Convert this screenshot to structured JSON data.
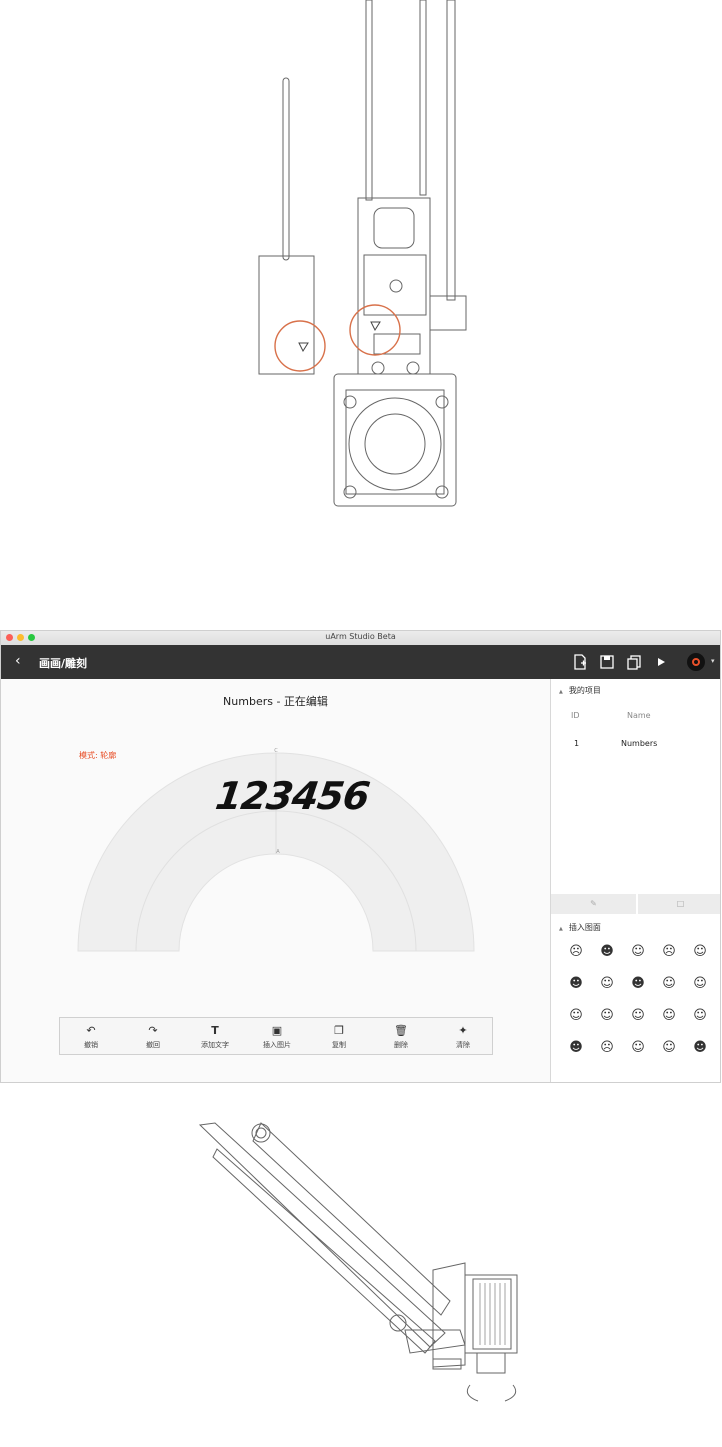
{
  "window": {
    "title": "uArm Studio Beta",
    "traffic_colors": [
      "#fc5f57",
      "#fdbc2e",
      "#28c840"
    ]
  },
  "toolbar": {
    "back_icon": "chevron-left-icon",
    "breadcrumb": "画画/雕刻",
    "actions": [
      "new-file-icon",
      "save-icon",
      "copy-icon",
      "play-icon"
    ]
  },
  "canvas": {
    "document_title": "Numbers - 正在编辑",
    "mode_label": "模式: 轮廓",
    "artwork_text": "123456",
    "accent_color": "#e84c24",
    "guide_top_label": "C",
    "guide_mid_label": "A"
  },
  "tools": [
    {
      "icon": "undo-icon",
      "label": "撤销"
    },
    {
      "icon": "redo-icon",
      "label": "撤回"
    },
    {
      "icon": "text-icon",
      "label": "添加文字"
    },
    {
      "icon": "image-icon",
      "label": "插入图片"
    },
    {
      "icon": "duplicate-icon",
      "label": "复制"
    },
    {
      "icon": "trash-icon",
      "label": "删除"
    },
    {
      "icon": "eraser-icon",
      "label": "清除"
    }
  ],
  "panel": {
    "projects_header": "我的项目",
    "columns": [
      "ID",
      "Name"
    ],
    "rows": [
      {
        "id": "1",
        "name": "Numbers"
      }
    ],
    "emoji_header": "插入图面",
    "emoji_glyphs": [
      "☹",
      "☻",
      "☺",
      "☹",
      "☺",
      "☻",
      "☺",
      "☻",
      "☺",
      "☺",
      "☺",
      "☺",
      "☺",
      "☺",
      "☺",
      "☻",
      "☹",
      "☺",
      "☺",
      "☻"
    ]
  }
}
